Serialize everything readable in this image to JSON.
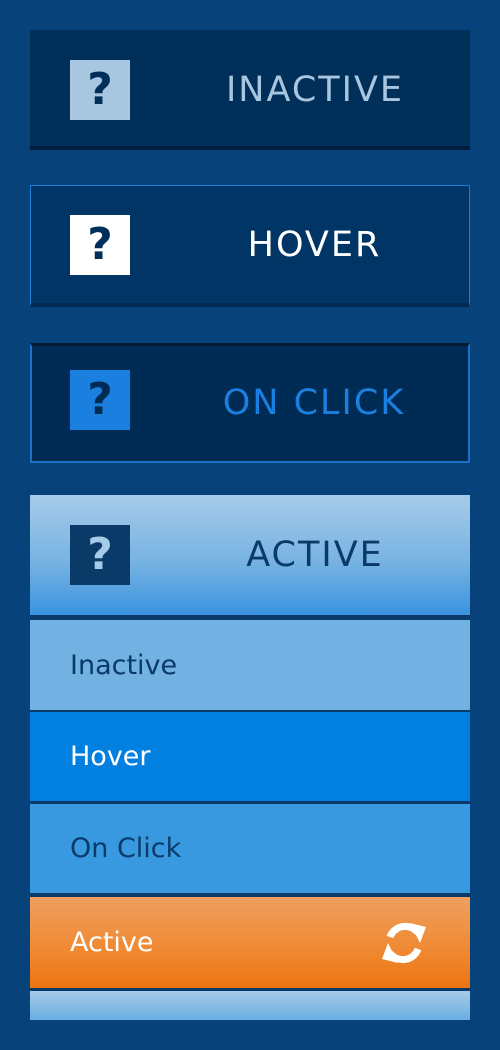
{
  "buttons": {
    "inactive": {
      "icon": "question-icon",
      "glyph": "?",
      "label": "INACTIVE"
    },
    "hover": {
      "icon": "question-icon",
      "glyph": "?",
      "label": "HOVER"
    },
    "click": {
      "icon": "question-icon",
      "glyph": "?",
      "label": "ON CLICK"
    },
    "active": {
      "icon": "question-icon",
      "glyph": "?",
      "label": "ACTIVE"
    }
  },
  "menu": {
    "items": [
      {
        "label": "Inactive"
      },
      {
        "label": "Hover"
      },
      {
        "label": "On Click"
      },
      {
        "label": "Active",
        "icon": "refresh-icon"
      }
    ]
  },
  "colors": {
    "background": "#07437a",
    "dark_navy": "#002f59",
    "accent_blue": "#1b7fe0",
    "hover_blue": "#0280e0",
    "active_orange": "#f08830"
  }
}
